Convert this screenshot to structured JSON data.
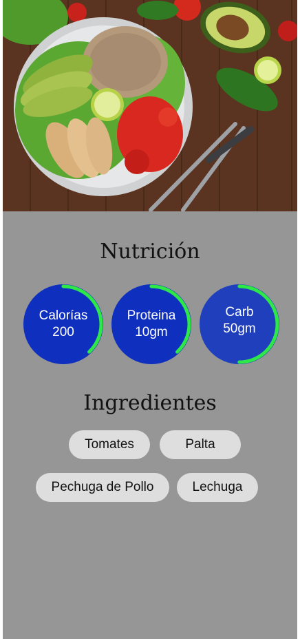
{
  "hero": {
    "alt": "bowl salad"
  },
  "nutrition": {
    "title": "Nutrición",
    "items": [
      {
        "label": "Calorías",
        "value": "200",
        "progress": 0.38,
        "color": "#0f2fbf",
        "arc": "#2ee84a"
      },
      {
        "label": "Proteina",
        "value": "10gm",
        "progress": 0.38,
        "color": "#0f2fbf",
        "arc": "#2ee84a"
      },
      {
        "label": "Carb",
        "value": "50gm",
        "progress": 0.5,
        "color": "#1f3fbd",
        "arc": "#2ee84a"
      }
    ]
  },
  "ingredients": {
    "title": "Ingredientes",
    "items": [
      "Tomates",
      "Palta",
      "Pechuga de Pollo",
      "Lechuga"
    ]
  },
  "colors": {
    "panel": "#969696",
    "chip": "#dedede",
    "ring_track": "#0f2fbf",
    "ring_arc": "#2ee84a"
  }
}
